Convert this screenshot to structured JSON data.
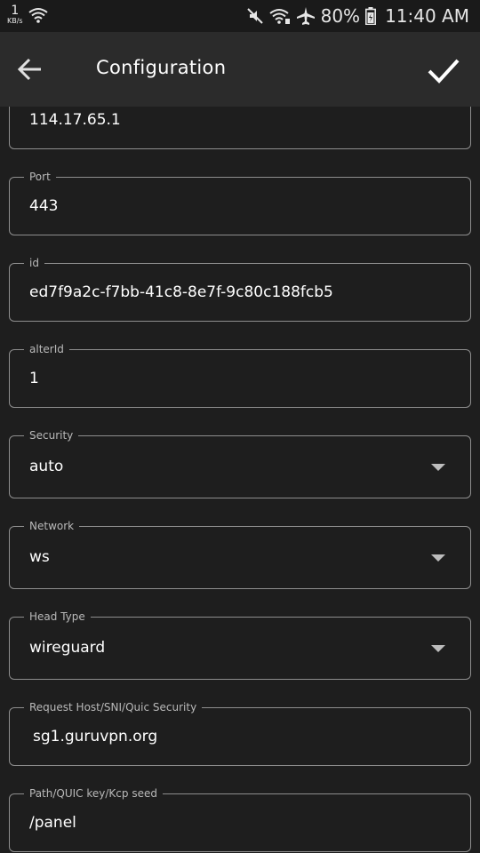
{
  "status_bar": {
    "speed_value": "1",
    "speed_unit": "KB/s",
    "battery": "80%",
    "time": "11:40 AM",
    "icons": [
      "wifi-icon",
      "mute-icon",
      "wifi-calling-icon",
      "airplane-icon",
      "battery-icon"
    ]
  },
  "app_bar": {
    "title": "Configuration",
    "back_icon": "arrow-back-icon",
    "save_icon": "check-icon"
  },
  "form": {
    "address_value": "114.17.65.1",
    "port": {
      "label": "Port",
      "value": "443"
    },
    "id": {
      "label": "id",
      "value": "ed7f9a2c-f7bb-41c8-8e7f-9c80c188fcb5"
    },
    "alterId": {
      "label": "alterId",
      "value": "1"
    },
    "security": {
      "label": "Security",
      "value": "auto"
    },
    "network": {
      "label": "Network",
      "value": "ws"
    },
    "head_type": {
      "label": "Head Type",
      "value": "wireguard"
    },
    "request_host": {
      "label": "Request Host/SNI/Quic Security",
      "value": "sg1.guruvpn.org"
    },
    "path": {
      "label": "Path/QUIC key/Kcp seed",
      "value": "/panel"
    }
  },
  "colors": {
    "background": "#1e1e1e",
    "app_bar": "#2b2b2b",
    "status_bar": "#1a1a1a",
    "field_border": "#8e8e8e"
  }
}
